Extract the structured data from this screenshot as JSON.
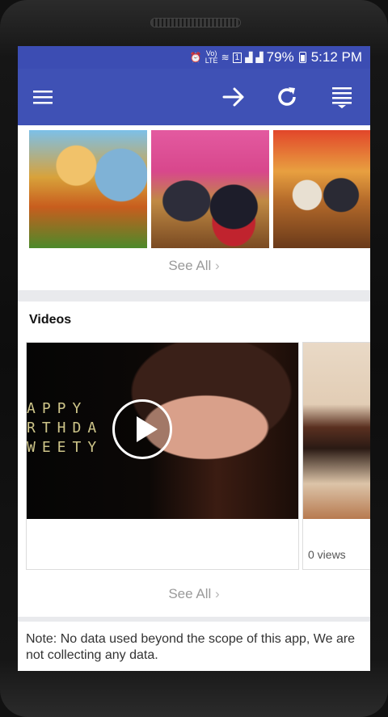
{
  "status_bar": {
    "volte_top": "Vo)",
    "volte_bottom": "LTE",
    "sim_badge": "1",
    "battery": "79%",
    "time": "5:12 PM"
  },
  "photos": {
    "see_all": "See All"
  },
  "videos": {
    "title": "Videos",
    "items": [
      {
        "overlay_text": "APPY\nRTHDA\nWEETY",
        "views": ""
      },
      {
        "views": "0 views"
      }
    ],
    "see_all": "See All"
  },
  "note": "Note: No data used beyond the scope of this app, We are not collecting any data.",
  "colors": {
    "status_bar": "#3c4db3",
    "app_bar": "#3f51b5",
    "background": "#e9eaed"
  }
}
